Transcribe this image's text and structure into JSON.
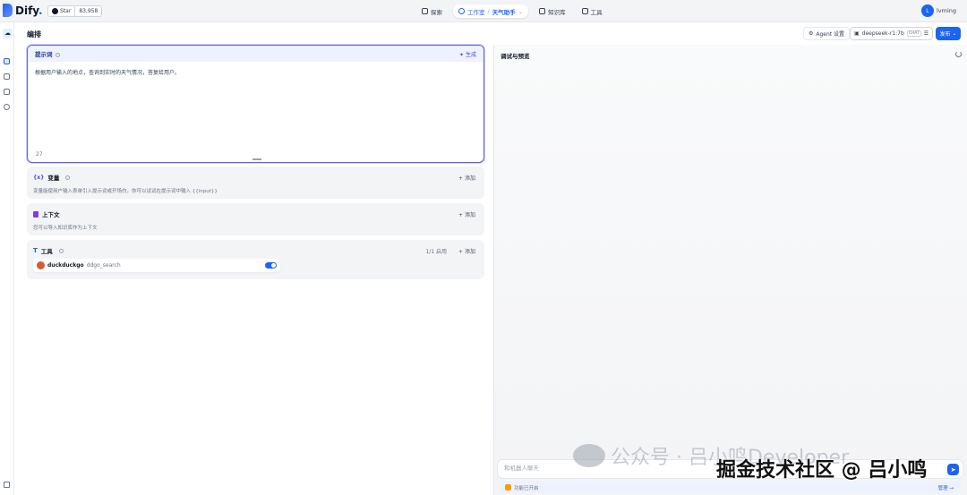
{
  "header": {
    "logo_text": "Dify",
    "github": {
      "label": "Star",
      "count": "83,958"
    },
    "nav": [
      {
        "label": "探索"
      },
      {
        "label": "工作室",
        "app": "天气助手"
      },
      {
        "label": "知识库"
      },
      {
        "label": "工具"
      }
    ],
    "user": {
      "initial": "L",
      "name": "lvming"
    }
  },
  "page": {
    "title": "编排",
    "agent_settings": "Agent 设置",
    "model": {
      "name": "deepseek-r1:7b",
      "badge": "CHAT"
    },
    "publish": "发布"
  },
  "prompt": {
    "title": "提示词",
    "generate": "生成",
    "text": "根据用户输入的地点，查询到实时的天气情况，答复给用户。",
    "count": "27"
  },
  "variables": {
    "title": "变量",
    "add": "添加",
    "desc": "变量能使用户输入表单引入提示词或开场白，你可以试试在提示词中输入 {{input}}"
  },
  "context": {
    "title": "上下文",
    "add": "添加",
    "desc": "您可以导入知识库作为上下文"
  },
  "tools": {
    "title": "工具",
    "enabled": "1/1 启用",
    "add": "添加",
    "items": [
      {
        "provider": "duckduckgo",
        "name": "ddgo_search",
        "enabled": true
      }
    ]
  },
  "preview": {
    "title": "调试与预览",
    "input_placeholder": "和机器人聊天",
    "feature_text": "功能已开启",
    "manage": "管理"
  },
  "watermark": {
    "line1": "公众号 · 吕小鸣Developer",
    "line2": "掘金技术社区 @ 吕小鸣"
  },
  "colors": {
    "accent": "#1c64f2",
    "prompt_border": "#6d5cdc"
  }
}
